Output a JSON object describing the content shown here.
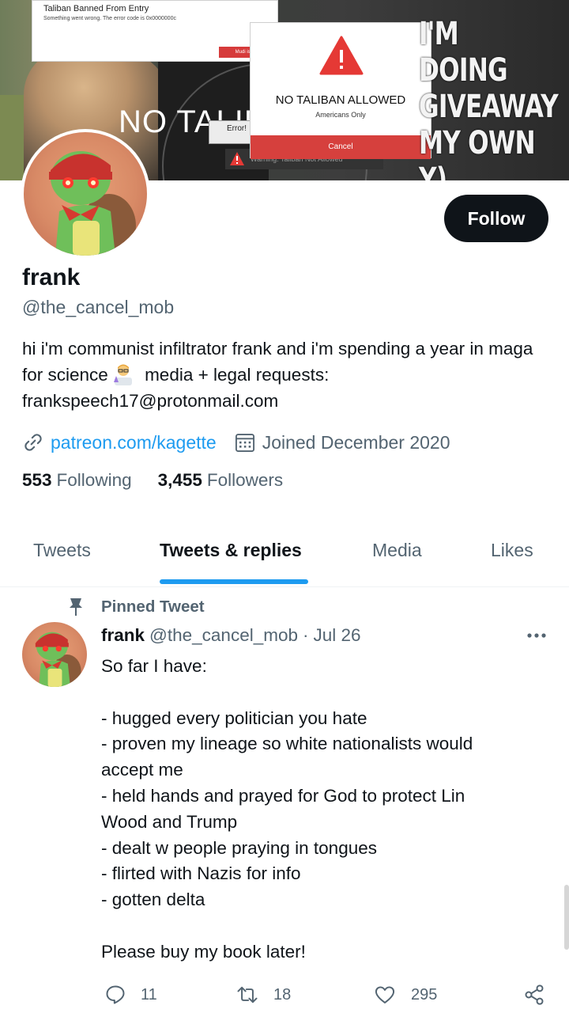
{
  "banner": {
    "window_title": "Taliban Banned From Entry",
    "window_message": "Something went wrong. The error code is 0x0000000c",
    "window_button": "Mudi is an Ar",
    "dialog_title": "NO TALIBAN ALLOWED",
    "dialog_subtitle": "Americans Only",
    "dialog_button": "Cancel",
    "big_text": "NO TALIB",
    "error_label": "Error!",
    "warning_text": "Warning: Taliban Not Allowed",
    "overlay_lines": [
      "I'M DOING",
      "GIVEAWAY",
      "MY OWN",
      "Y)"
    ]
  },
  "profile": {
    "follow_label": "Follow",
    "display_name": "frank",
    "handle": "@the_cancel_mob",
    "bio_part1": "hi i'm communist infiltrator frank and i'm spending a year in maga for science",
    "bio_emoji": "scientist-emoji",
    "bio_part2": " media + legal requests: frankspeech17@protonmail.com",
    "link": "patreon.com/kagette",
    "joined": "Joined December 2020",
    "following_count": "553",
    "following_label": "Following",
    "followers_count": "3,455",
    "followers_label": "Followers"
  },
  "tabs": [
    {
      "label": "Tweets",
      "active": false
    },
    {
      "label": "Tweets & replies",
      "active": true
    },
    {
      "label": "Media",
      "active": false
    },
    {
      "label": "Likes",
      "active": false
    }
  ],
  "tweet": {
    "pinned_label": "Pinned Tweet",
    "author_name": "frank",
    "author_handle": "@the_cancel_mob",
    "separator": "·",
    "date": "Jul 26",
    "lines": [
      "So far I have:",
      "",
      "- hugged every politician you hate",
      "- proven my lineage so white nationalists would",
      "accept me",
      "- held hands and prayed for God to protect Lin",
      "Wood and Trump",
      "- dealt w people praying in tongues",
      "- flirted with Nazis for info",
      "- gotten delta",
      "",
      "Please buy my book later!"
    ],
    "replies": "11",
    "retweets": "18",
    "likes": "295"
  },
  "icons": {
    "link": "link-icon",
    "calendar": "calendar-icon",
    "pin": "pin-icon",
    "more": "more-icon",
    "reply": "reply-icon",
    "retweet": "retweet-icon",
    "like": "like-icon",
    "share": "share-icon"
  },
  "colors": {
    "accent": "#1d9bf0",
    "text": "#0f1419",
    "muted": "#536471",
    "follow_bg": "#0f1419"
  }
}
